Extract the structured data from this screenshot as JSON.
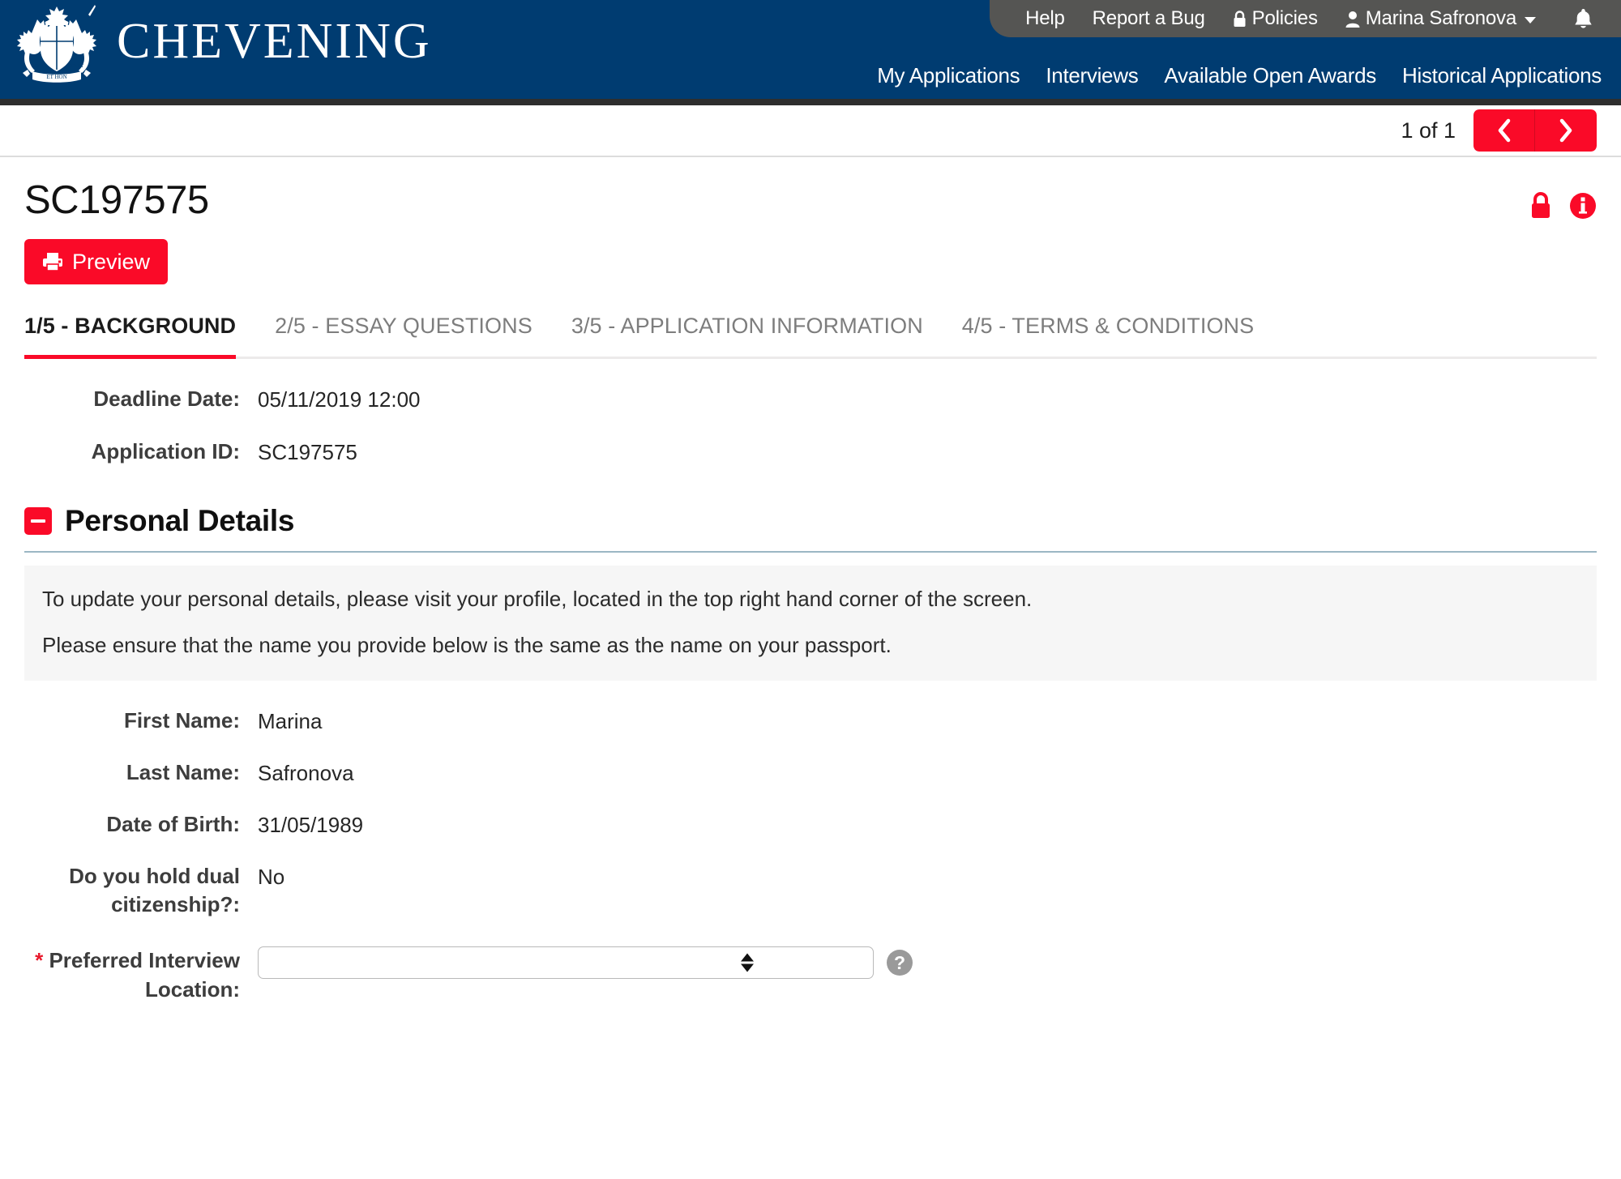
{
  "brand": {
    "name": "CHEVENING",
    "crest_icon": "royal-coat-of-arms"
  },
  "utility_nav": {
    "items": [
      {
        "label": "Help",
        "icon": null
      },
      {
        "label": "Report a Bug",
        "icon": null
      },
      {
        "label": "Policies",
        "icon": "lock-icon"
      },
      {
        "label": "Marina Safronova",
        "icon": "user-icon",
        "caret": true
      }
    ],
    "notifications_icon": "bell-icon"
  },
  "main_nav": {
    "items": [
      {
        "label": "My Applications"
      },
      {
        "label": "Interviews"
      },
      {
        "label": "Available Open Awards"
      },
      {
        "label": "Historical Applications"
      }
    ]
  },
  "pager": {
    "count_label": "1 of 1",
    "prev_icon": "chevron-left-icon",
    "next_icon": "chevron-right-icon"
  },
  "header": {
    "title": "SC197575",
    "lock_icon": "lock-icon",
    "info_icon": "info-circle-icon",
    "preview_label": "Preview",
    "preview_icon": "printer-icon"
  },
  "tabs": [
    {
      "label": "1/5 - BACKGROUND",
      "active": true
    },
    {
      "label": "2/5 - ESSAY QUESTIONS",
      "active": false
    },
    {
      "label": "3/5 - APPLICATION INFORMATION",
      "active": false
    },
    {
      "label": "4/5 - TERMS & CONDITIONS",
      "active": false
    }
  ],
  "summary": {
    "deadline_label": "Deadline Date:",
    "deadline_value": "05/11/2019 12:00",
    "application_id_label": "Application ID:",
    "application_id_value": "SC197575"
  },
  "personal_details": {
    "section_title": "Personal Details",
    "collapse_icon": "minus-square-icon",
    "info_paragraph_1": "To update your personal details, please visit your profile, located in the top right hand corner of the screen.",
    "info_paragraph_2": "Please ensure that the name you provide below is the same as the name on your passport.",
    "fields": [
      {
        "label": "First Name:",
        "value": "Marina"
      },
      {
        "label": "Last Name:",
        "value": "Safronova"
      },
      {
        "label": "Date of Birth:",
        "value": "31/05/1989"
      },
      {
        "label": "Do you hold dual citizenship?:",
        "value": "No"
      }
    ],
    "interview_location": {
      "required_marker": "*",
      "label": "Preferred Interview Location:",
      "selected_value": "",
      "help_icon": "question-circle-icon"
    }
  },
  "colors": {
    "navy": "#003c71",
    "gray_bar": "#555553",
    "accent_red": "#fa0a28",
    "rule_blue": "#9bb7c4",
    "panel_gray": "#f6f6f6"
  }
}
